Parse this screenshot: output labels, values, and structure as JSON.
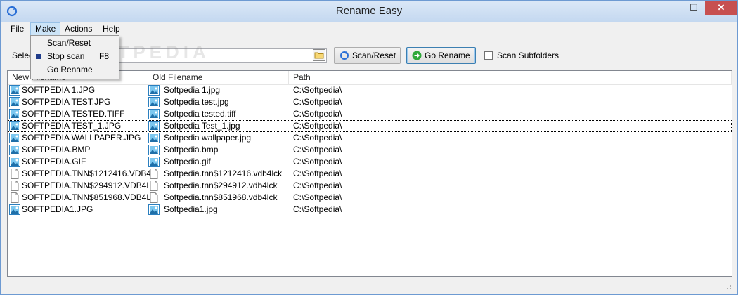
{
  "window": {
    "title": "Rename Easy"
  },
  "titlebar": {
    "minimize": "—",
    "maximize": "☐",
    "close": "✕"
  },
  "menubar": {
    "items": [
      "File",
      "Make",
      "Actions",
      "Help"
    ],
    "active": "Make"
  },
  "make_menu": {
    "items": [
      {
        "label": "Scan/Reset",
        "shortcut": ""
      },
      {
        "label": "Stop scan",
        "shortcut": "F8"
      },
      {
        "label": "Go Rename",
        "shortcut": ""
      }
    ]
  },
  "toolbar": {
    "select_label": "Selec",
    "path_value": "",
    "scan_button": "Scan/Reset",
    "go_button": "Go Rename",
    "scan_subfolders_label": "Scan Subfolders",
    "scan_subfolders_checked": false
  },
  "watermark": "SOFTPEDIA",
  "list": {
    "columns": [
      "New Filename",
      "Old Filename",
      "Path"
    ],
    "rows": [
      {
        "new": "SOFTPEDIA 1.JPG",
        "old": "Softpedia 1.jpg",
        "path": "C:\\Softpedia\\",
        "icon": "image-file-icon"
      },
      {
        "new": "SOFTPEDIA TEST.JPG",
        "old": "Softpedia test.jpg",
        "path": "C:\\Softpedia\\",
        "icon": "image-file-icon"
      },
      {
        "new": "SOFTPEDIA TESTED.TIFF",
        "old": "Softpedia tested.tiff",
        "path": "C:\\Softpedia\\",
        "icon": "image-file-icon"
      },
      {
        "new": "SOFTPEDIA TEST_1.JPG",
        "old": "Softpedia Test_1.jpg",
        "path": "C:\\Softpedia\\",
        "icon": "image-file-icon",
        "selected": true
      },
      {
        "new": "SOFTPEDIA WALLPAPER.JPG",
        "old": "Softpedia wallpaper.jpg",
        "path": "C:\\Softpedia\\",
        "icon": "image-file-icon"
      },
      {
        "new": "SOFTPEDIA.BMP",
        "old": "Softpedia.bmp",
        "path": "C:\\Softpedia\\",
        "icon": "image-file-icon"
      },
      {
        "new": "SOFTPEDIA.GIF",
        "old": "Softpedia.gif",
        "path": "C:\\Softpedia\\",
        "icon": "image-file-icon"
      },
      {
        "new": "SOFTPEDIA.TNN$1212416.VDB4...",
        "old": "Softpedia.tnn$1212416.vdb4lck",
        "path": "C:\\Softpedia\\",
        "icon": "blank-file-icon"
      },
      {
        "new": "SOFTPEDIA.TNN$294912.VDB4L...",
        "old": "Softpedia.tnn$294912.vdb4lck",
        "path": "C:\\Softpedia\\",
        "icon": "blank-file-icon"
      },
      {
        "new": "SOFTPEDIA.TNN$851968.VDB4L...",
        "old": "Softpedia.tnn$851968.vdb4lck",
        "path": "C:\\Softpedia\\",
        "icon": "blank-file-icon"
      },
      {
        "new": "SOFTPEDIA1.JPG",
        "old": "Softpedia1.jpg",
        "path": "C:\\Softpedia\\",
        "icon": "image-file-icon"
      }
    ]
  }
}
